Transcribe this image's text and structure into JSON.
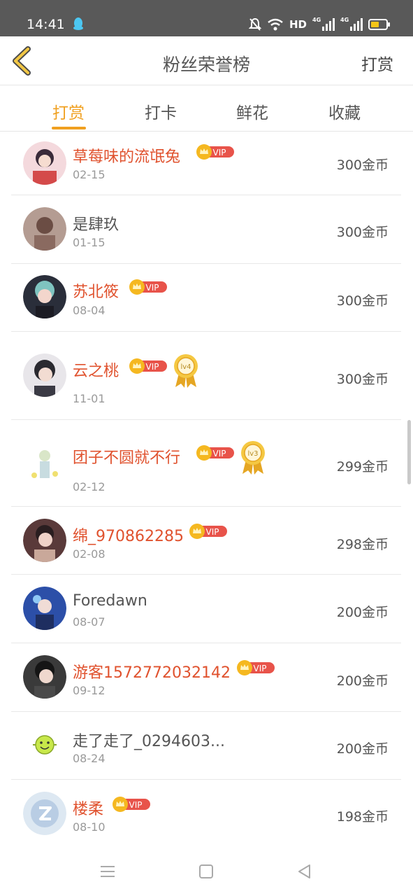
{
  "status_bar": {
    "time": "14:41",
    "network_label": "HD",
    "net_a": "4G",
    "net_b": "4G"
  },
  "header": {
    "title": "粉丝荣誉榜",
    "action": "打赏"
  },
  "tabs": [
    {
      "label": "打赏",
      "active": true
    },
    {
      "label": "打卡",
      "active": false
    },
    {
      "label": "鲜花",
      "active": false
    },
    {
      "label": "收藏",
      "active": false
    }
  ],
  "colors": {
    "accent": "#f0a020",
    "vip_name": "#e0522e",
    "vip_badge": "#e8534a"
  },
  "vip_label": "VIP",
  "rows": [
    {
      "name": "草莓味的流氓兔",
      "date": "02-15",
      "amount": "300金币",
      "vip": true,
      "medal": ""
    },
    {
      "name": "是肆玖",
      "date": "01-15",
      "amount": "300金币",
      "vip": false,
      "medal": ""
    },
    {
      "name": "苏北筱",
      "date": "08-04",
      "amount": "300金币",
      "vip": true,
      "medal": ""
    },
    {
      "name": "云之桃",
      "date": "11-01",
      "amount": "300金币",
      "vip": true,
      "medal": "lv4"
    },
    {
      "name": "团子不圆就不行",
      "date": "02-12",
      "amount": "299金币",
      "vip": true,
      "medal": "lv3"
    },
    {
      "name": "绵_970862285",
      "date": "02-08",
      "amount": "298金币",
      "vip": true,
      "medal": ""
    },
    {
      "name": "Foredawn",
      "date": "08-07",
      "amount": "200金币",
      "vip": false,
      "medal": ""
    },
    {
      "name": "游客1572772032142",
      "date": "09-12",
      "amount": "200金币",
      "vip": true,
      "medal": ""
    },
    {
      "name": "走了走了_0294603...",
      "date": "08-24",
      "amount": "200金币",
      "vip": false,
      "medal": ""
    },
    {
      "name": "楼柔",
      "date": "08-10",
      "amount": "198金币",
      "vip": true,
      "medal": ""
    }
  ],
  "icons": {
    "back": "chevron-left-icon",
    "nav": [
      "menu-icon",
      "home-square-icon",
      "back-triangle-icon"
    ]
  }
}
